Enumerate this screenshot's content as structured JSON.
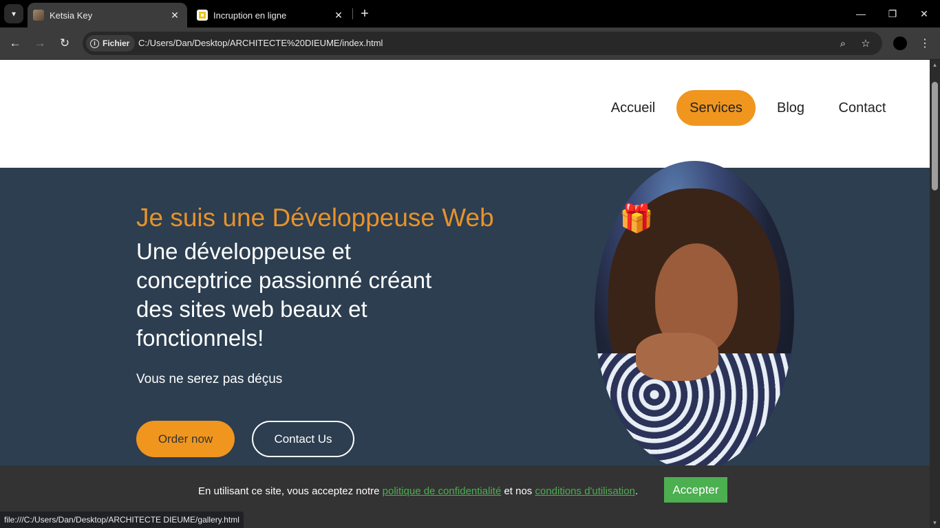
{
  "browser": {
    "tabs": [
      {
        "title": "Ketsia Key",
        "active": true
      },
      {
        "title": "Incruption en ligne",
        "active": false
      }
    ],
    "new_tab_label": "+",
    "address": {
      "chip_label": "Fichier",
      "url": "C:/Users/Dan/Desktop/ARCHITECTE%20DIEUME/index.html"
    },
    "status_url": "file:///C:/Users/Dan/Desktop/ARCHITECTE DIEUME/gallery.html",
    "icons": {
      "tab_search": "▾",
      "close": "✕",
      "back": "←",
      "forward": "→",
      "reload": "↻",
      "zoom": "⌕",
      "star": "☆",
      "menu": "⋮",
      "minimize": "—",
      "restore": "❐",
      "window_close": "✕",
      "info": "i",
      "scroll_up": "▲",
      "scroll_down": "▼"
    }
  },
  "site": {
    "nav": [
      {
        "label": "Accueil",
        "active": false
      },
      {
        "label": "Services",
        "active": true
      },
      {
        "label": "Blog",
        "active": false
      },
      {
        "label": "Contact",
        "active": false
      }
    ],
    "hero": {
      "kicker": "Je suis une Développeuse Web",
      "title": "Une développeuse et conceptrice passionné créant des sites web beaux et fonctionnels!",
      "subtitle": "Vous ne serez pas déçus",
      "order_button": "Order now",
      "contact_button": "Contact Us",
      "gift_icon": "🎁"
    },
    "cookie": {
      "text_before": "En utilisant ce site, vous acceptez notre ",
      "privacy_link": "politique de confidentialité",
      "text_middle": " et nos ",
      "terms_link": "conditions d'utilisation",
      "text_after": ".",
      "accept_button": "Accepter"
    }
  },
  "colors": {
    "accent_orange": "#f0961e",
    "hero_bg": "#2c3e50",
    "cookie_bg": "#333333",
    "accept_green": "#4caf50"
  }
}
